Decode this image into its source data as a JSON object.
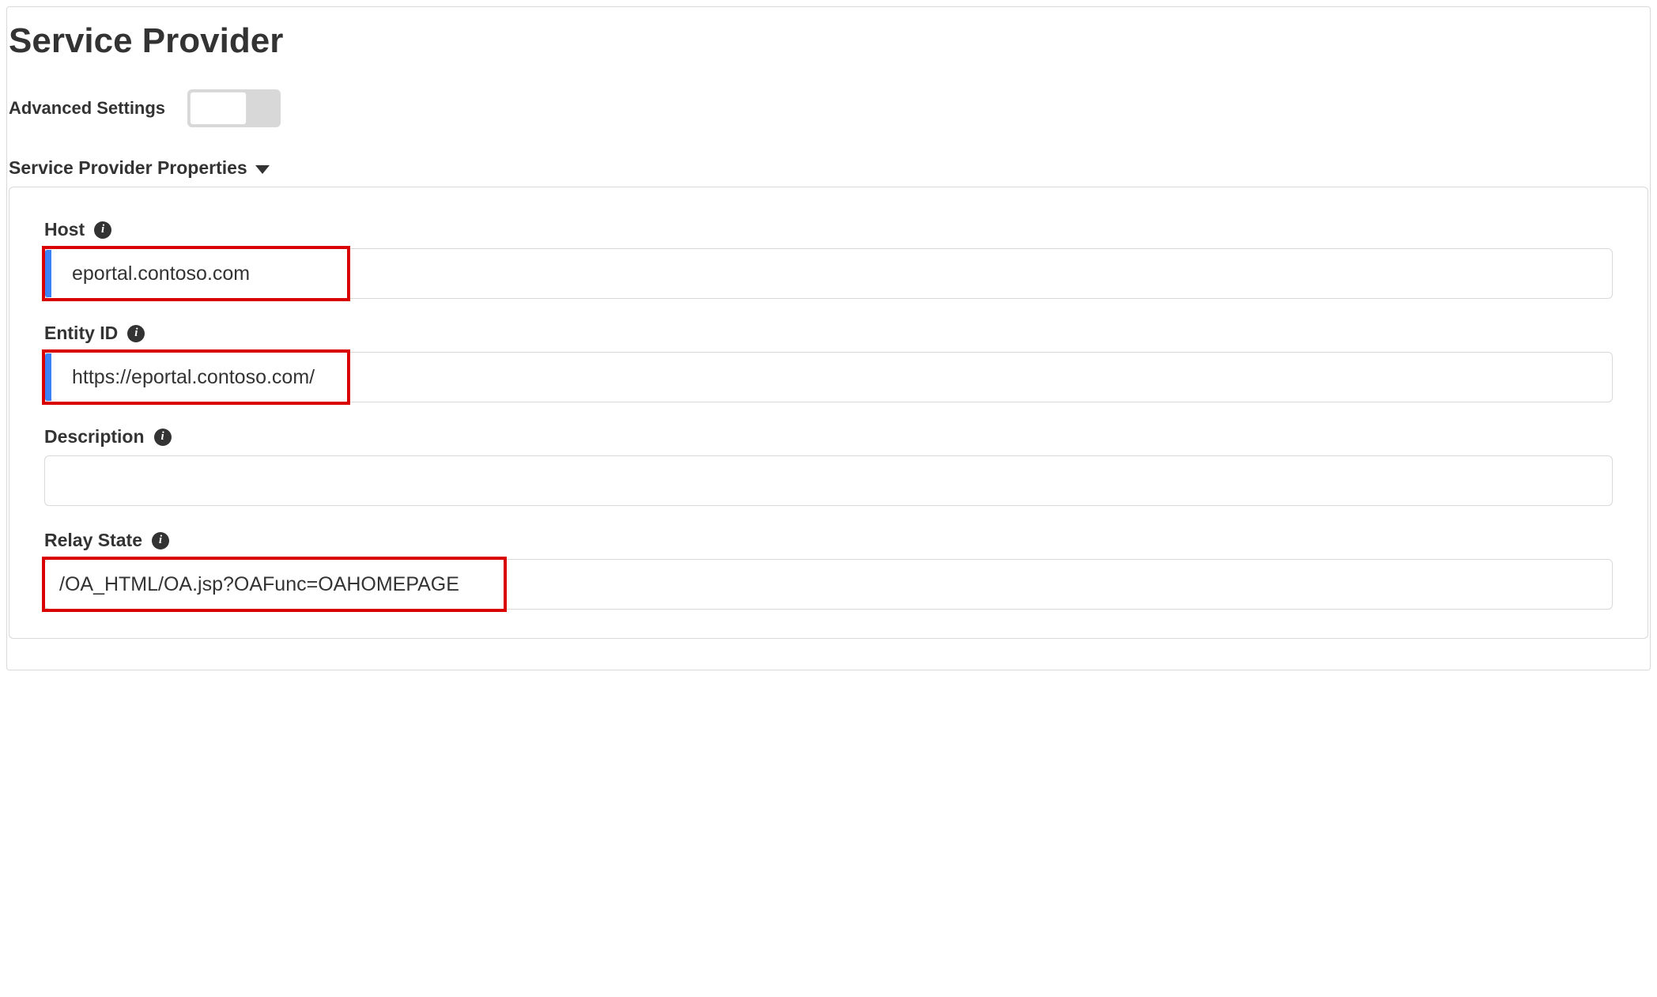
{
  "page": {
    "title": "Service Provider",
    "advanced_settings_label": "Advanced Settings",
    "section_title": "Service Provider Properties",
    "fields": {
      "host": {
        "label": "Host",
        "value": "eportal.contoso.com"
      },
      "entity_id": {
        "label": "Entity ID",
        "value": "https://eportal.contoso.com/"
      },
      "description": {
        "label": "Description",
        "value": ""
      },
      "relay_state": {
        "label": "Relay State",
        "value": "/OA_HTML/OA.jsp?OAFunc=OAHOMEPAGE"
      }
    }
  }
}
